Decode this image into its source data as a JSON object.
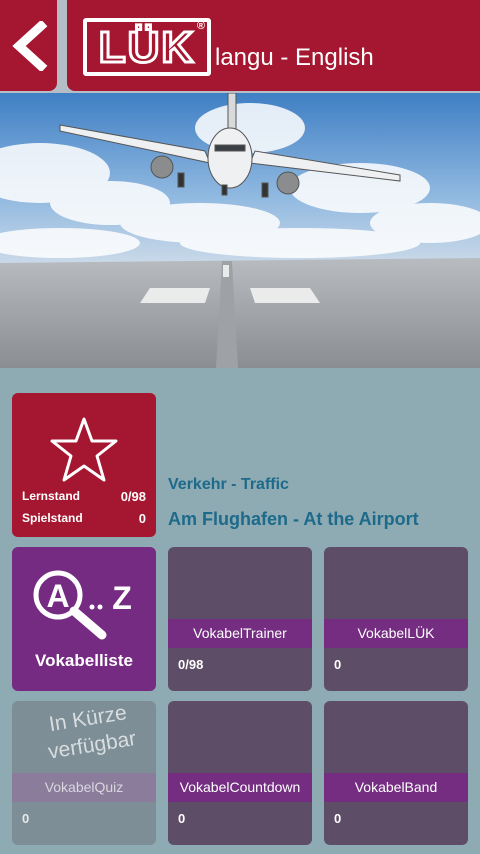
{
  "header": {
    "logo_text": "LÜK",
    "logo_reg": "®",
    "title": "langu - English"
  },
  "hero": {
    "icon": "airplane-runway-photo"
  },
  "lesson": {
    "stats": [
      {
        "label": "Lernstand",
        "value": "0/98"
      },
      {
        "label": "Spielstand",
        "value": "0"
      }
    ],
    "category": "Verkehr - Traffic",
    "title": "Am Flughafen - At the Airport"
  },
  "tiles": {
    "vokabelliste": {
      "label": "Vokabelliste",
      "icon_text_a": "A",
      "icon_text_z": "Z"
    },
    "trainer": {
      "label": "VokabelTrainer",
      "count": "0/98"
    },
    "luk": {
      "label": "VokabelLÜK",
      "count": "0"
    },
    "quiz": {
      "soon_line1": "In Kürze",
      "soon_line2": "verfügbar",
      "label": "VokabelQuiz",
      "count": "0"
    },
    "countdown": {
      "label": "VokabelCountdown",
      "count": "0"
    },
    "band": {
      "label": "VokabelBand",
      "count": "0"
    }
  },
  "colors": {
    "brand_red": "#a51630",
    "purple": "#752b82",
    "tile_gray_purple": "#5d4d66",
    "background": "#8eaab3",
    "text_blue": "#1d6a8a"
  }
}
